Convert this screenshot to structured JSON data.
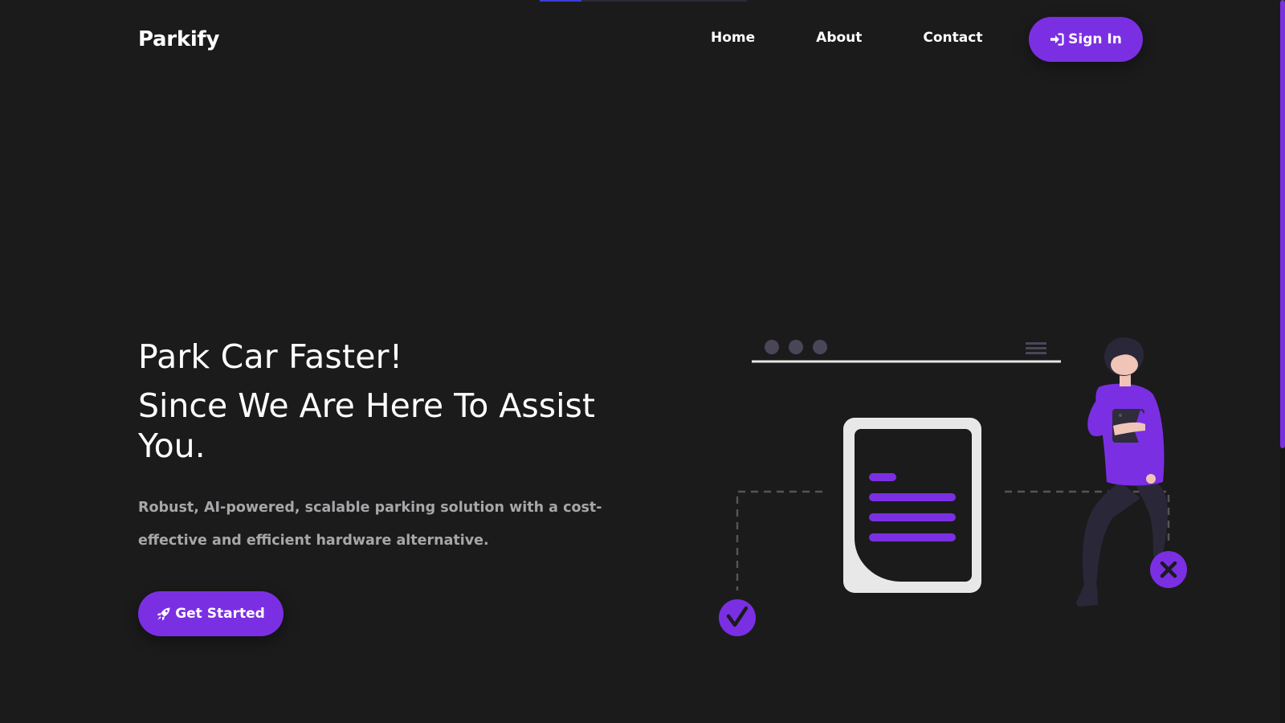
{
  "brand": {
    "name": "Parkify",
    "accent": "#7b2fe3",
    "background": "#1b1b1c"
  },
  "nav": {
    "home": "Home",
    "about": "About",
    "contact": "Contact",
    "signin": "Sign In",
    "signin_icon": "sign-in-icon"
  },
  "hero": {
    "line1": "Park Car Faster!",
    "line2": "Since We Are Here To Assist You.",
    "description": "Robust, AI-powered, scalable parking solution with a cost-effective and efficient hardware alternative.",
    "cta": "Get Started",
    "cta_icon": "rocket-icon"
  },
  "illustration": {
    "name": "woman-with-document-illustration",
    "icons": [
      "check-icon",
      "close-icon",
      "menu-icon",
      "document-icon"
    ]
  },
  "top_progress_fraction": 0.2,
  "scroll_fraction": 0.62
}
